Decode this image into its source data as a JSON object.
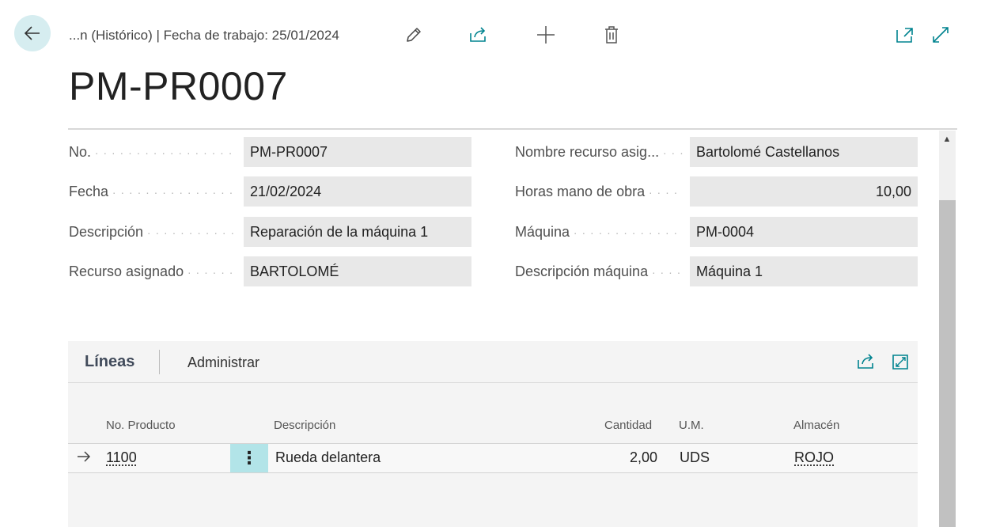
{
  "header": {
    "breadcrumb": "...n (Histórico) | Fecha de trabajo: 25/01/2024",
    "title": "PM-PR0007",
    "icons": [
      "back-arrow-icon",
      "edit-pencil-icon",
      "share-icon",
      "add-plus-icon",
      "delete-trash-icon",
      "open-new-window-icon",
      "expand-icon"
    ]
  },
  "fields": {
    "left": [
      {
        "label": "No.",
        "value": "PM-PR0007"
      },
      {
        "label": "Fecha",
        "value": "21/02/2024"
      },
      {
        "label": "Descripción",
        "value": "Reparación de la máquina 1"
      },
      {
        "label": "Recurso asignado",
        "value": "BARTOLOMÉ"
      }
    ],
    "right": [
      {
        "label": "Nombre recurso asig...",
        "value": "Bartolomé Castellanos"
      },
      {
        "label": "Horas mano de obra",
        "value": "10,00"
      },
      {
        "label": "Máquina",
        "value": "PM-0004"
      },
      {
        "label": "Descripción máquina",
        "value": "Máquina 1"
      }
    ]
  },
  "lines": {
    "tab_title": "Líneas",
    "tab_manage": "Administrar",
    "columns": [
      "No. Producto",
      "Descripción",
      "Cantidad",
      "U.M.",
      "Almacén"
    ],
    "rows": [
      {
        "product_no": "1100",
        "description": "Rueda delantera",
        "quantity": "2,00",
        "uom": "UDS",
        "location": "ROJO"
      }
    ]
  },
  "colors": {
    "accent": "#00838f",
    "back_button_bg": "#d6edf0",
    "field_bg": "#e8e8e8",
    "selected_cell": "#b2e4e8"
  }
}
